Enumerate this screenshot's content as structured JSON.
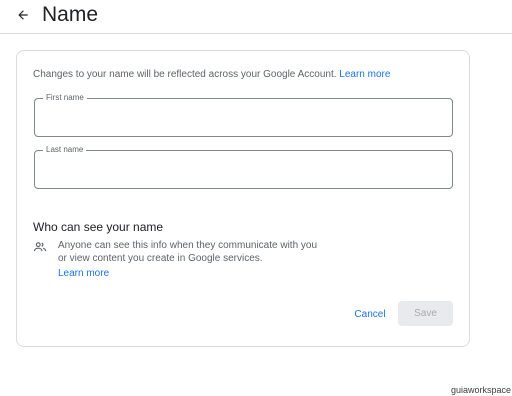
{
  "header": {
    "title": "Name",
    "back_icon": "arrow-back-icon"
  },
  "card": {
    "intro_text": "Changes to your name will be reflected across your Google Account.",
    "intro_link": "Learn more",
    "first_name": {
      "label": "First name",
      "value": ""
    },
    "last_name": {
      "label": "Last name",
      "value": ""
    },
    "visibility": {
      "title": "Who can see your name",
      "icon": "people-icon",
      "text": "Anyone can see this info when they communicate with you or view content you create in Google services.",
      "link": "Learn more"
    },
    "actions": {
      "cancel_label": "Cancel",
      "save_label": "Save"
    }
  },
  "watermark": "guiaworkspace",
  "colors": {
    "link": "#1a73e8",
    "border": "#dadce0",
    "text_secondary": "#5f6368",
    "disabled_bg": "#e8eaed"
  }
}
